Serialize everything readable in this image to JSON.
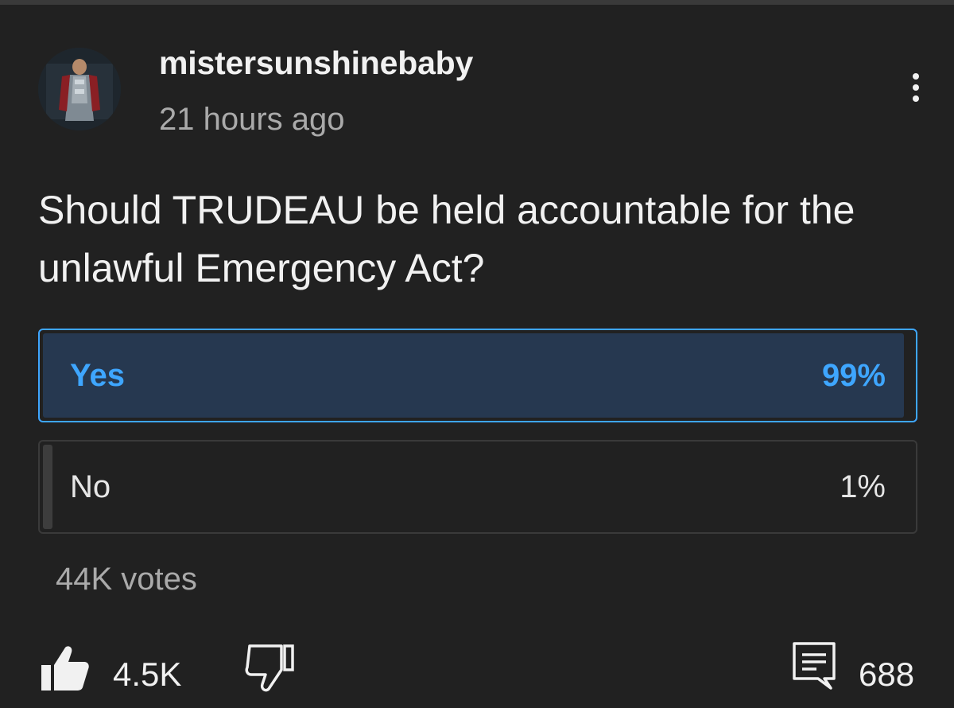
{
  "post": {
    "username": "mistersunshinebaby",
    "timestamp": "21 hours ago",
    "question": "Should TRUDEAU be held accountable for the unlawful Emergency Act?"
  },
  "poll": {
    "options": [
      {
        "label": "Yes",
        "percent_label": "99%",
        "percent": 99,
        "selected": true
      },
      {
        "label": "No",
        "percent_label": "1%",
        "percent": 1,
        "selected": false
      }
    ],
    "votes": "44K votes"
  },
  "actions": {
    "likes": "4.5K",
    "comments": "688"
  },
  "icons": {
    "menu": "more-vert-icon",
    "like": "thumbs-up-filled-icon",
    "dislike": "thumbs-down-outline-icon",
    "comment": "comment-icon"
  },
  "colors": {
    "background": "#212121",
    "accent": "#3ea6ff",
    "selected_fill": "#263850",
    "muted_text": "#aaaaaa"
  }
}
